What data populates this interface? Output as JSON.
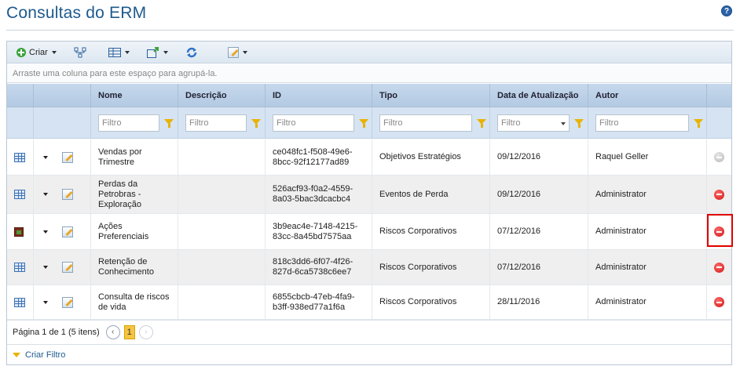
{
  "page": {
    "title": "Consultas do ERM",
    "help_icon": "?"
  },
  "toolbar": {
    "create_label": "Criar"
  },
  "grid": {
    "group_hint": "Arraste uma coluna para este espaço para agrupá-la.",
    "columns": [
      "Nome",
      "Descrição",
      "ID",
      "Tipo",
      "Data de Atualização",
      "Autor"
    ],
    "filter_placeholder": "Filtro",
    "rows": [
      {
        "icon": "table-icon",
        "name": "Vendas por Trimestre",
        "description": "",
        "id": "ce048fc1-f508-49e6-8bcc-92f12177ad89",
        "type": "Objetivos Estratégios",
        "updated": "09/12/2016",
        "author": "Raquel Geller",
        "delete_enabled": false
      },
      {
        "icon": "table-icon",
        "name": "Perdas da Petrobras - Exploração",
        "description": "",
        "id": "526acf93-f0a2-4559-8a03-5bac3dcacbc4",
        "type": "Eventos de Perda",
        "updated": "09/12/2016",
        "author": "Administrator",
        "delete_enabled": true
      },
      {
        "icon": "chart-icon",
        "name": "Ações Preferenciais",
        "description": "",
        "id": "3b9eac4e-7148-4215-83cc-8a45bd7575aa",
        "type": "Riscos Corporativos",
        "updated": "07/12/2016",
        "author": "Administrator",
        "delete_enabled": true
      },
      {
        "icon": "table-icon",
        "name": "Retenção de Conhecimento",
        "description": "",
        "id": "818c3dd6-6f07-4f26-827d-6ca5738c6ee7",
        "type": "Riscos Corporativos",
        "updated": "07/12/2016",
        "author": "Administrator",
        "delete_enabled": true
      },
      {
        "icon": "table-icon",
        "name": "Consulta de riscos de vida",
        "description": "",
        "id": "6855cbcb-47eb-4fa9-b3ff-938ed77a1f6a",
        "type": "Riscos Corporativos",
        "updated": "28/11/2016",
        "author": "Administrator",
        "delete_enabled": true
      }
    ]
  },
  "pager": {
    "summary": "Página 1 de 1 (5 itens)",
    "prev": "‹",
    "current": "1",
    "next": "›"
  },
  "footer": {
    "create_filter_label": "Criar Filtro"
  },
  "colors": {
    "title": "#1d5a8e",
    "header_bg": "#b3cae3",
    "filter_bg": "#d5e3f2",
    "delete_red": "#d01515",
    "highlight": "#e00000"
  }
}
